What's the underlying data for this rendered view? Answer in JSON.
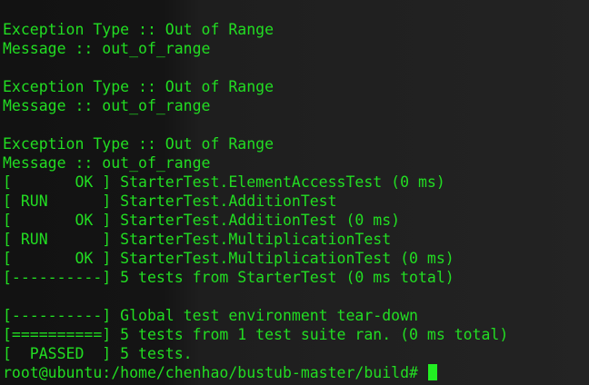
{
  "terminal": {
    "lines": [
      "Exception Type :: Out of Range",
      "Message :: out_of_range",
      "",
      "Exception Type :: Out of Range",
      "Message :: out_of_range",
      "",
      "Exception Type :: Out of Range",
      "Message :: out_of_range",
      "[       OK ] StarterTest.ElementAccessTest (0 ms)",
      "[ RUN      ] StarterTest.AdditionTest",
      "[       OK ] StarterTest.AdditionTest (0 ms)",
      "[ RUN      ] StarterTest.MultiplicationTest",
      "[       OK ] StarterTest.MultiplicationTest (0 ms)",
      "[----------] 5 tests from StarterTest (0 ms total)",
      "",
      "[----------] Global test environment tear-down",
      "[==========] 5 tests from 1 test suite ran. (0 ms total)",
      "[  PASSED  ] 5 tests."
    ],
    "prompt": "root@ubuntu:/home/chenhao/bustub-master/build# ",
    "colors": {
      "text": "#22dd22",
      "background": "#1a1a1a",
      "cursor": "#22ee22"
    }
  }
}
